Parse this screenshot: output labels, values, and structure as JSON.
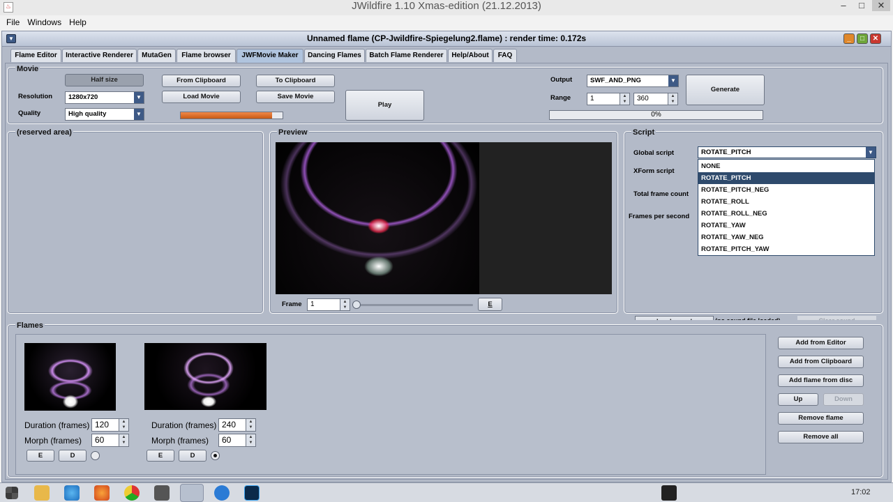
{
  "titlebar": {
    "title": "JWildfire 1.10 Xmas-edition (21.12.2013)"
  },
  "menu": [
    "File",
    "Windows",
    "Help"
  ],
  "internal": {
    "title": "Unnamed flame (CP-Jwildfire-Spiegelung2.flame) : render time: 0.172s"
  },
  "tabs": [
    "Flame Editor",
    "Interactive Renderer",
    "MutaGen",
    "Flame browser",
    "JWFMovie Maker",
    "Dancing Flames",
    "Batch Flame Renderer",
    "Help/About",
    "FAQ"
  ],
  "movie": {
    "title": "Movie",
    "half_size": "Half size",
    "resolution_label": "Resolution",
    "resolution": "1280x720",
    "quality_label": "Quality",
    "quality": "High quality",
    "from_clipboard": "From Clipboard",
    "load_movie": "Load Movie",
    "to_clipboard": "To Clipboard",
    "save_movie": "Save Movie",
    "play": "Play",
    "progress_fraction": 0.9,
    "output_label": "Output",
    "output": "SWF_AND_PNG",
    "range_label": "Range",
    "range_from": "1",
    "range_to": "360",
    "generate": "Generate",
    "gen_progress": "0%"
  },
  "reserved": {
    "title": "(reserved area)"
  },
  "preview": {
    "title": "Preview",
    "frame_label": "Frame",
    "frame_value": "1",
    "e_button": "E"
  },
  "script": {
    "title": "Script",
    "global_label": "Global script",
    "global_value": "ROTATE_PITCH",
    "xform_label": "XForm script",
    "total_label": "Total frame count",
    "fps_label": "Frames per second",
    "options": [
      "NONE",
      "ROTATE_PITCH",
      "ROTATE_PITCH_NEG",
      "ROTATE_ROLL",
      "ROTATE_ROLL_NEG",
      "ROTATE_YAW",
      "ROTATE_YAW_NEG",
      "ROTATE_PITCH_YAW"
    ],
    "selected_index": 1,
    "load_sound": "Load sound",
    "sound_status": "(no sound file loaded)",
    "clear_sound": "Clear sound"
  },
  "flames": {
    "title": "Flames",
    "duration_label": "Duration (frames)",
    "morph_label": "Morph (frames)",
    "e": "E",
    "d": "D",
    "items": [
      {
        "duration": "120",
        "morph": "60",
        "selected": false
      },
      {
        "duration": "240",
        "morph": "60",
        "selected": true
      }
    ]
  },
  "flame_actions": {
    "add_editor": "Add from Editor",
    "add_clipboard": "Add from Clipboard",
    "add_disc": "Add flame from disc",
    "up": "Up",
    "down": "Down",
    "remove": "Remove flame",
    "remove_all": "Remove all"
  },
  "taskbar": {
    "clock": "17:02"
  },
  "colors": {
    "accent": "#3e5a86",
    "progress": "#d9681f",
    "selection": "#2e4a6c"
  }
}
